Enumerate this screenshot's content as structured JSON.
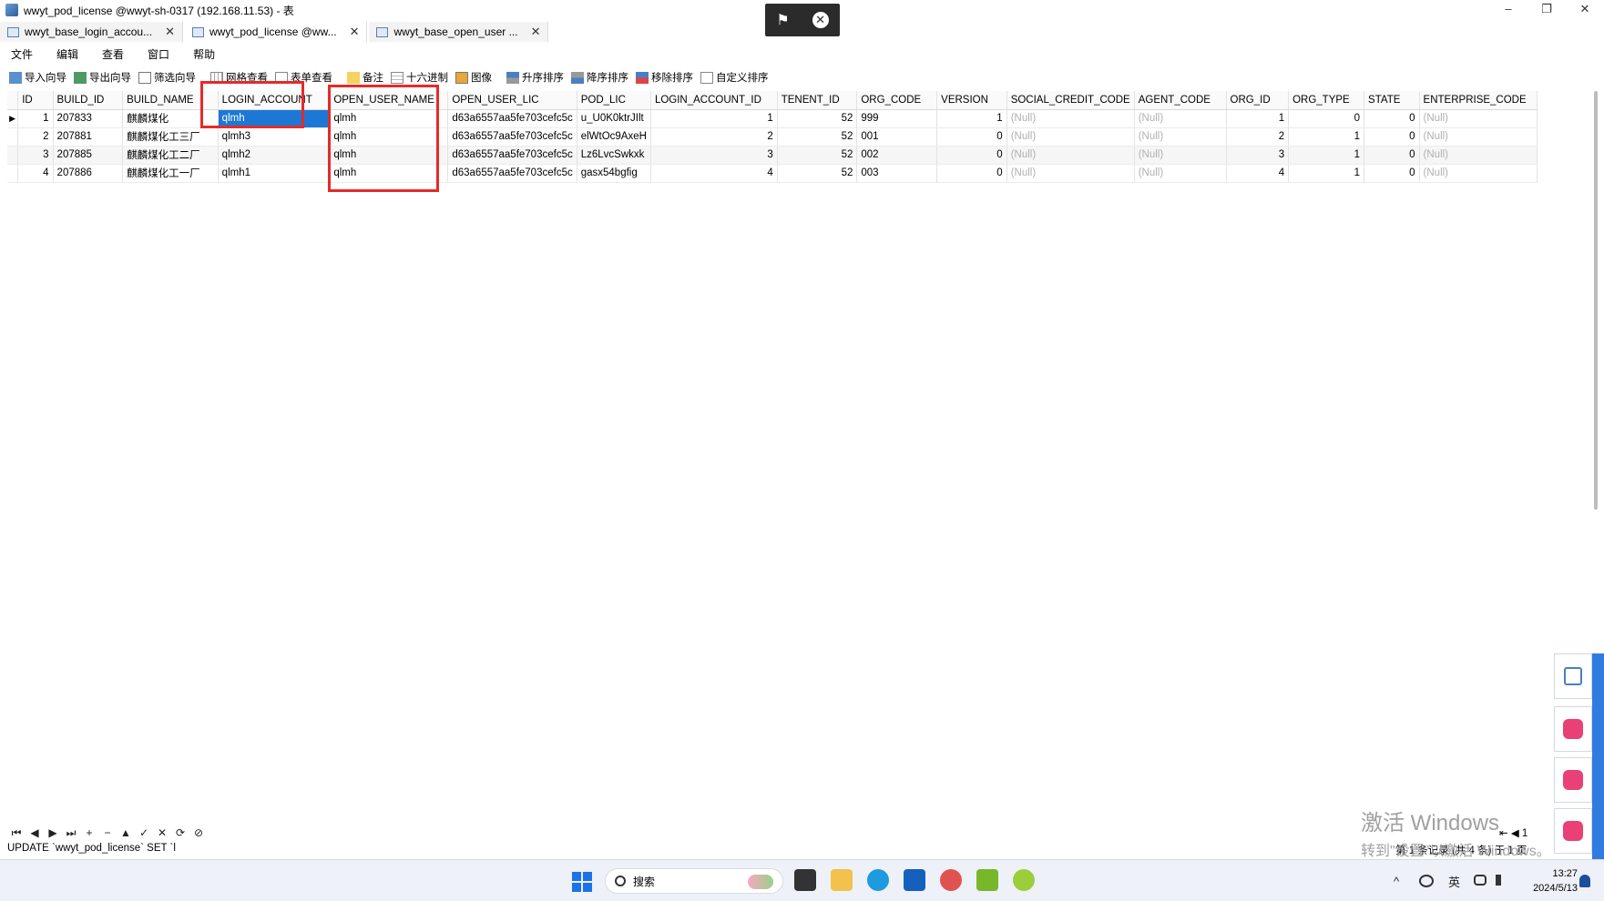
{
  "window": {
    "title": "wwyt_pod_license @wwyt-sh-0317 (192.168.11.53) - 表",
    "controls": [
      "–",
      "❐",
      "✕"
    ]
  },
  "remote_bar": {
    "pin": "⚑",
    "close": "✕"
  },
  "tabs": [
    {
      "label": "wwyt_base_login_accou...",
      "close": "✕"
    },
    {
      "label": "wwyt_pod_license @ww...",
      "close": "✕"
    },
    {
      "label": "wwyt_base_open_user ...",
      "close": "✕"
    }
  ],
  "menu": [
    "文件",
    "编辑",
    "查看",
    "窗口",
    "帮助"
  ],
  "toolbar": [
    {
      "label": "导入向导",
      "icon": "import-icon"
    },
    {
      "label": "导出向导",
      "icon": "export-icon"
    },
    {
      "label": "筛选向导",
      "icon": "filter-icon"
    },
    {
      "label": "网格查看",
      "icon": "grid-view-icon"
    },
    {
      "label": "表单查看",
      "icon": "form-view-icon"
    },
    {
      "label": "备注",
      "icon": "note-icon"
    },
    {
      "label": "十六进制",
      "icon": "hex-icon"
    },
    {
      "label": "图像",
      "icon": "image-icon"
    },
    {
      "label": "升序排序",
      "icon": "sort-asc-icon"
    },
    {
      "label": "降序排序",
      "icon": "sort-desc-icon"
    },
    {
      "label": "移除排序",
      "icon": "sort-remove-icon"
    },
    {
      "label": "自定义排序",
      "icon": "sort-custom-icon"
    }
  ],
  "grid": {
    "columns": [
      "ID",
      "BUILD_ID",
      "BUILD_NAME",
      "LOGIN_ACCOUNT",
      "OPEN_USER_NAME",
      "OPEN_USER_LIC",
      "POD_LIC",
      "LOGIN_ACCOUNT_ID",
      "TENENT_ID",
      "ORG_CODE",
      "VERSION",
      "SOCIAL_CREDIT_CODE",
      "AGENT_CODE",
      "ORG_ID",
      "ORG_TYPE",
      "STATE",
      "ENTERPRISE_CODE"
    ],
    "rows": [
      [
        "1",
        "207833",
        "麒麟煤化",
        "qlmh",
        "qlmh",
        "d63a6557aa5fe703cefc5c",
        "u_U0K0ktrJIlt",
        "1",
        "52",
        "999",
        "1",
        "(Null)",
        "(Null)",
        "1",
        "0",
        "0",
        "(Null)"
      ],
      [
        "2",
        "207881",
        "麒麟煤化工三厂",
        "qlmh3",
        "qlmh",
        "d63a6557aa5fe703cefc5c",
        "elWtOc9AxeH",
        "2",
        "52",
        "001",
        "0",
        "(Null)",
        "(Null)",
        "2",
        "1",
        "0",
        "(Null)"
      ],
      [
        "3",
        "207885",
        "麒麟煤化工二厂",
        "qlmh2",
        "qlmh",
        "d63a6557aa5fe703cefc5c",
        "Lz6LvcSwkxk",
        "3",
        "52",
        "002",
        "0",
        "(Null)",
        "(Null)",
        "3",
        "1",
        "0",
        "(Null)"
      ],
      [
        "4",
        "207886",
        "麒麟煤化工一厂",
        "qlmh1",
        "qlmh",
        "d63a6557aa5fe703cefc5c",
        "gasx54bgfig",
        "4",
        "52",
        "003",
        "0",
        "(Null)",
        "(Null)",
        "4",
        "1",
        "0",
        "(Null)"
      ]
    ],
    "current_row_marker": "▶"
  },
  "navigator": [
    "⏮",
    "◀",
    "▶",
    "⏭",
    "+",
    "−",
    "▲",
    "✓",
    "✕",
    "⟳",
    "⊘"
  ],
  "status": {
    "sql": "UPDATE `wwyt_pod_license` SET `l",
    "record": "第 1 条记录 (共 4 条) 于 1 页",
    "page": "1"
  },
  "watermark": {
    "line1": "激活 Windows",
    "line2": "转到\"设置\"以激活 Windows。"
  },
  "taskbar": {
    "search_placeholder": "搜索",
    "tray": {
      "chevron": "^",
      "ime": "英"
    },
    "time": "13:27",
    "date": "2024/5/13"
  }
}
